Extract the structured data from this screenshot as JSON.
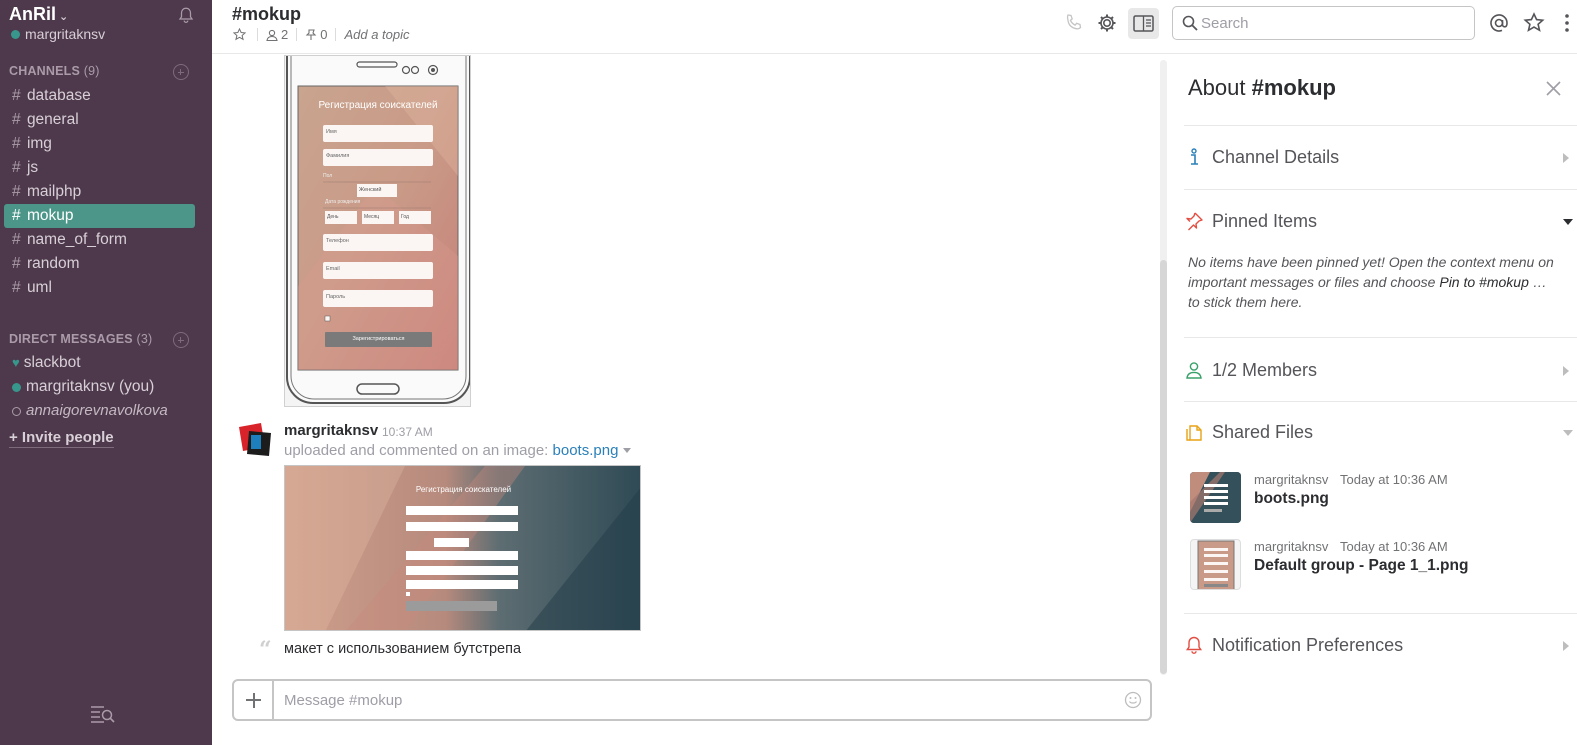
{
  "sidebar": {
    "team_name": "AnRil",
    "user_name": "margritaknsv",
    "channels_header": "CHANNELS",
    "channels_count": "(9)",
    "channels": [
      {
        "name": "database"
      },
      {
        "name": "general"
      },
      {
        "name": "img"
      },
      {
        "name": "js"
      },
      {
        "name": "mailphp"
      },
      {
        "name": "mokup",
        "active": true
      },
      {
        "name": "name_of_form"
      },
      {
        "name": "random"
      },
      {
        "name": "uml"
      }
    ],
    "dm_header": "DIRECT MESSAGES",
    "dm_count": "(3)",
    "dms": [
      {
        "name": "slackbot",
        "status": "bot"
      },
      {
        "name": "margritaknsv (you)",
        "status": "online"
      },
      {
        "name": "annaigorevnavolkova",
        "status": "away"
      }
    ],
    "invite_label": "+ Invite people"
  },
  "header": {
    "channel": "#mokup",
    "members_count": "2",
    "pinned_count": "0",
    "topic_placeholder": "Add a topic",
    "search_placeholder": "Search"
  },
  "messages": {
    "phone_mock": {
      "title": "Регистрация соискателей",
      "fields": [
        "Имя",
        "Фамилия",
        "Телефон",
        "Email",
        "Пароль"
      ],
      "labels": [
        "Пол",
        "Дата рождения"
      ],
      "gender_value": "Женский",
      "date_selects": [
        "День",
        "Месяц",
        "Год"
      ],
      "button": "Зарегистрироваться"
    },
    "sender": "margritaknsv",
    "time": "10:37 AM",
    "upload_text": "uploaded and commented on an image:",
    "file_name": "boots.png",
    "preview_title": "Регистрация соискателей",
    "comment": "макет с использованием бутстрепа"
  },
  "composer": {
    "placeholder": "Message #mokup"
  },
  "panel": {
    "title_prefix": "About",
    "title_channel": "#mokup",
    "sections": {
      "details": "Channel Details",
      "pinned": "Pinned Items",
      "members": "1/2 Members",
      "files": "Shared Files",
      "notifications": "Notification Preferences"
    },
    "pinned_text_1": "No items have been pinned yet! Open the context menu on important messages or files and choose",
    "pinned_text_action": "Pin to #mokup",
    "pinned_text_2": "… to stick them here.",
    "files": [
      {
        "user": "margritaknsv",
        "time": "Today at 10:36 AM",
        "name": "boots.png"
      },
      {
        "user": "margritaknsv",
        "time": "Today at 10:36 AM",
        "name": "Default group - Page 1_1.png"
      }
    ]
  },
  "colors": {
    "sidebar_bg": "#4d394b",
    "active_channel": "#4c9689",
    "presence": "#38978d",
    "link": "#2a80b9"
  }
}
